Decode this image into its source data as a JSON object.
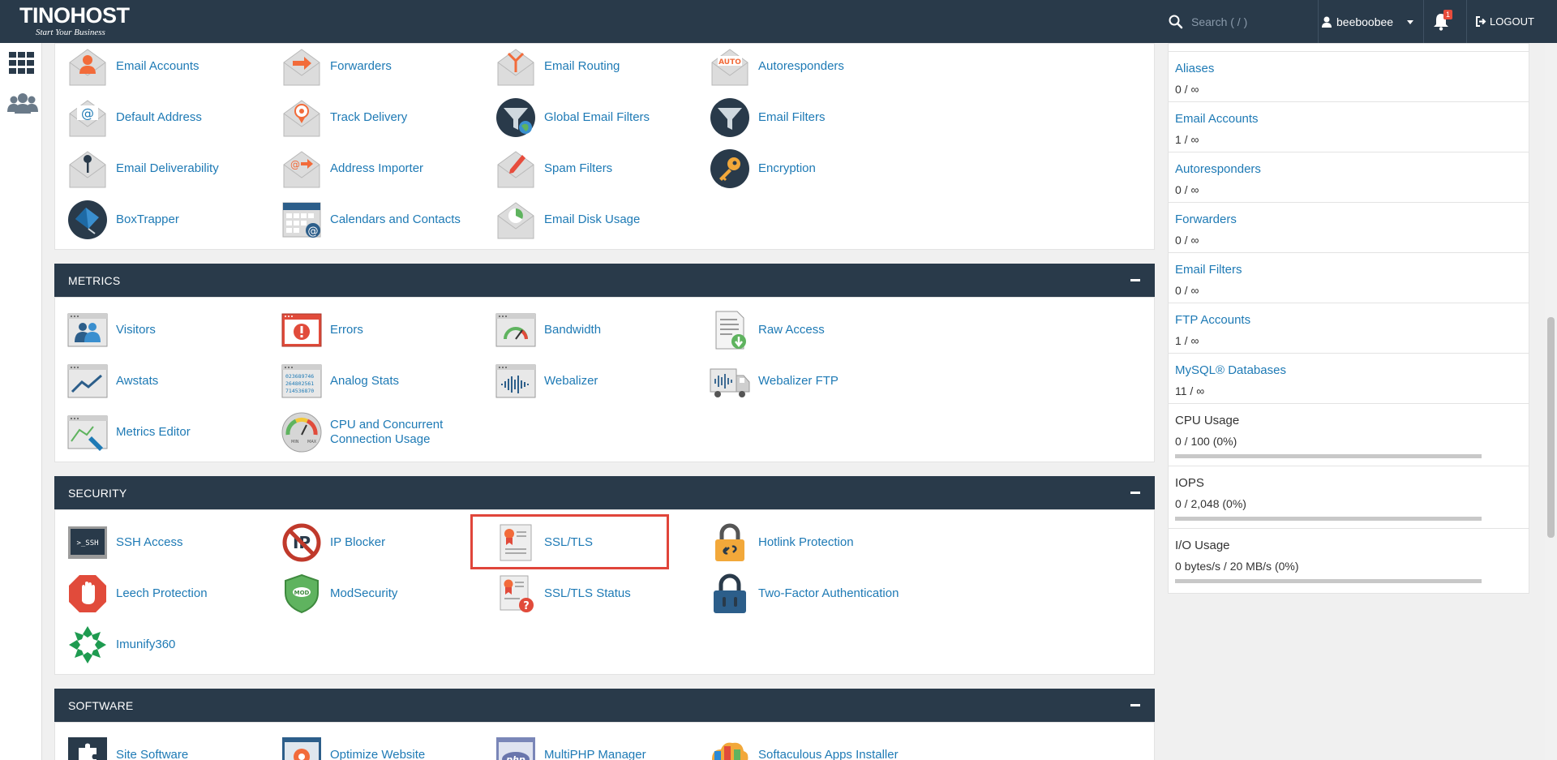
{
  "topbar": {
    "brand": "TINOHOST",
    "tagline": "Start Your Business",
    "search_placeholder": "Search ( / )",
    "username": "beeboobee",
    "notifications_count": "1",
    "logout_label": "LOGOUT"
  },
  "email": {
    "items": [
      "Email Accounts",
      "Forwarders",
      "Email Routing",
      "Autoresponders",
      "Default Address",
      "Track Delivery",
      "Global Email Filters",
      "Email Filters",
      "Email Deliverability",
      "Address Importer",
      "Spam Filters",
      "Encryption",
      "BoxTrapper",
      "Calendars and Contacts",
      "Email Disk Usage"
    ]
  },
  "metrics": {
    "title": "METRICS",
    "items": [
      "Visitors",
      "Errors",
      "Bandwidth",
      "Raw Access",
      "Awstats",
      "Analog Stats",
      "Webalizer",
      "Webalizer FTP",
      "Metrics Editor",
      "CPU and Concurrent Connection Usage"
    ]
  },
  "security": {
    "title": "SECURITY",
    "items": [
      "SSH Access",
      "IP Blocker",
      "SSL/TLS",
      "Hotlink Protection",
      "Leech Protection",
      "ModSecurity",
      "SSL/TLS Status",
      "Two-Factor Authentication",
      "Imunify360"
    ]
  },
  "software": {
    "title": "SOFTWARE",
    "items": [
      "Site Software",
      "Optimize Website",
      "MultiPHP Manager",
      "Softaculous Apps Installer"
    ]
  },
  "stats": [
    {
      "name": "Aliases",
      "value": "0 / ∞"
    },
    {
      "name": "Email Accounts",
      "value": "1 / ∞"
    },
    {
      "name": "Autoresponders",
      "value": "0 / ∞"
    },
    {
      "name": "Forwarders",
      "value": "0 / ∞"
    },
    {
      "name": "Email Filters",
      "value": "0 / ∞"
    },
    {
      "name": "FTP Accounts",
      "value": "1 / ∞"
    },
    {
      "name": "MySQL® Databases",
      "value": "11 / ∞"
    },
    {
      "name": "CPU Usage",
      "value": "0 / 100   (0%)",
      "percent": 0
    },
    {
      "name": "IOPS",
      "value": "0 / 2,048   (0%)",
      "percent": 0
    },
    {
      "name": "I/O Usage",
      "value": "0 bytes/s / 20 MB/s   (0%)",
      "percent": 0
    }
  ],
  "colors": {
    "topbar": "#293a4a",
    "link": "#1e7ab5",
    "highlight": "#e0453a"
  }
}
